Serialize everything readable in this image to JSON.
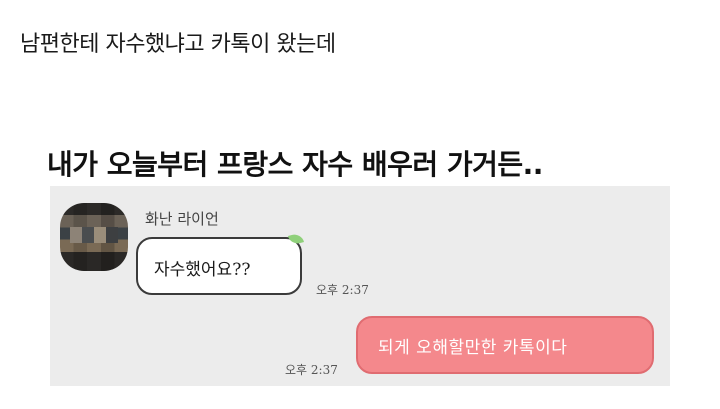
{
  "post": {
    "title": "남편한테 자수했냐고 카톡이 왔는데",
    "caption": "내가 오늘부터 프랑스 자수 배우러 가거든.."
  },
  "chat": {
    "background_color": "#ececec",
    "incoming": {
      "sender_name": "화난 라이언",
      "message": "자수했어요??",
      "time": "오후 2:37",
      "avatar": "pixelated-avatar-icon"
    },
    "outgoing": {
      "message": "되게 오해할만한 카톡이다",
      "time": "오후 2:37",
      "bubble_color": "#f4888c"
    }
  }
}
